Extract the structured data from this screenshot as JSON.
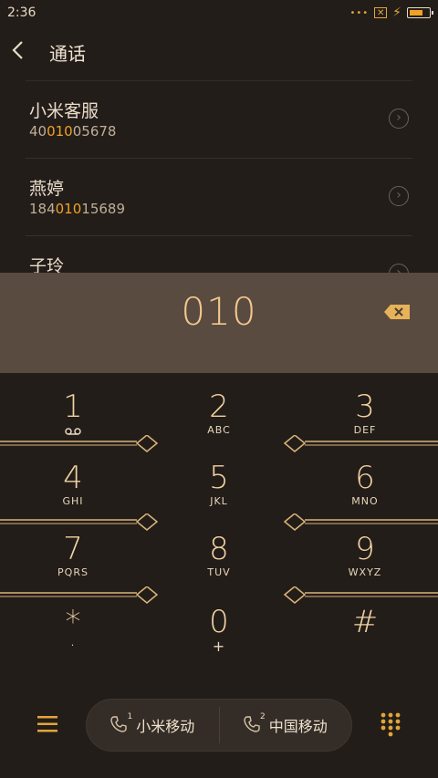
{
  "status": {
    "time": "2:36"
  },
  "header": {
    "title": "通话"
  },
  "contacts": [
    {
      "name": "小米客服",
      "num_pre": "40",
      "num_hl": "010",
      "num_post": "05678"
    },
    {
      "name": "燕婷",
      "num_pre": "184",
      "num_hl": "010",
      "num_post": "15689"
    },
    {
      "name": "子玲",
      "num_pre": "",
      "num_hl": "",
      "num_post": ""
    }
  ],
  "dial": {
    "number": "010"
  },
  "keys": [
    {
      "digit": "1",
      "letters": ""
    },
    {
      "digit": "2",
      "letters": "ABC"
    },
    {
      "digit": "3",
      "letters": "DEF"
    },
    {
      "digit": "4",
      "letters": "GHI"
    },
    {
      "digit": "5",
      "letters": "JKL"
    },
    {
      "digit": "6",
      "letters": "MNO"
    },
    {
      "digit": "7",
      "letters": "PQRS"
    },
    {
      "digit": "8",
      "letters": "TUV"
    },
    {
      "digit": "9",
      "letters": "WXYZ"
    },
    {
      "digit": "*",
      "letters": "·"
    },
    {
      "digit": "0",
      "letters": "+"
    },
    {
      "digit": "#",
      "letters": ""
    }
  ],
  "sims": [
    {
      "label": "小米移动",
      "slot": "1"
    },
    {
      "label": "中国移动",
      "slot": "2"
    }
  ],
  "colors": {
    "accent": "#f0a126",
    "gold": "#d9b47a",
    "background": "#231d19",
    "input_bar": "#5a4b40"
  }
}
